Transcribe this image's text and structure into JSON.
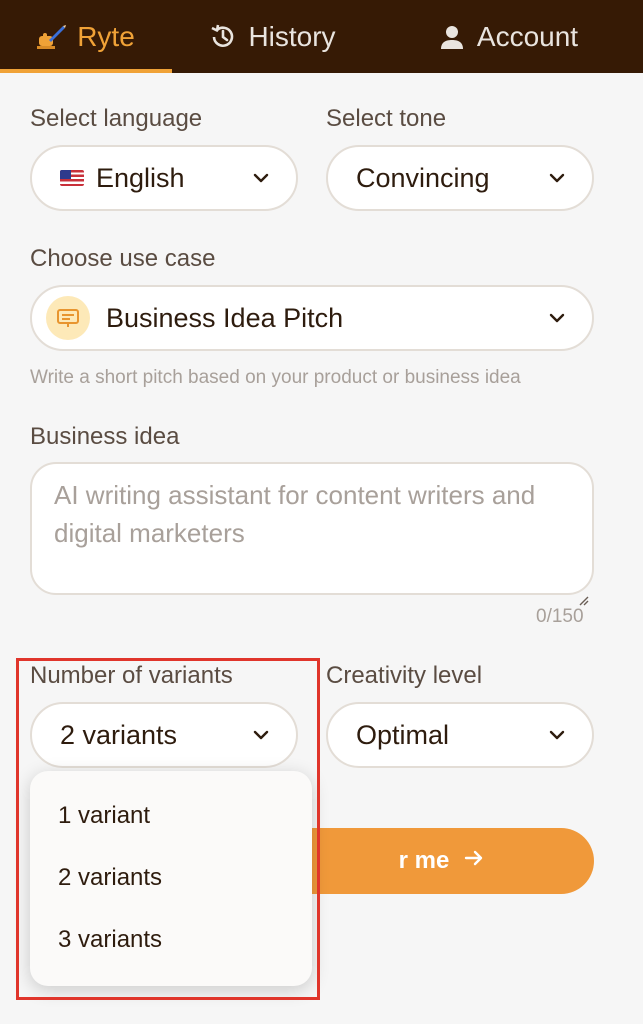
{
  "nav": {
    "tabs": [
      {
        "label": "Ryte",
        "icon": "writing-hand-icon",
        "active": true
      },
      {
        "label": "History",
        "icon": "history-icon"
      },
      {
        "label": "Account",
        "icon": "user-icon"
      }
    ]
  },
  "form": {
    "language": {
      "label": "Select language",
      "value": "English",
      "icon": "us-flag-icon"
    },
    "tone": {
      "label": "Select tone",
      "value": "Convincing"
    },
    "use_case": {
      "label": "Choose use case",
      "value": "Business Idea Pitch",
      "icon": "presentation-icon",
      "hint": "Write a short pitch based on your product or business idea"
    },
    "business_idea": {
      "label": "Business idea",
      "placeholder": "AI writing assistant for content writers and digital marketers",
      "value": "",
      "counter": "0/150"
    },
    "variants": {
      "label": "Number of variants",
      "value": "2 variants",
      "options": [
        "1 variant",
        "2 variants",
        "3 variants"
      ]
    },
    "creativity": {
      "label": "Creativity level",
      "value": "Optimal"
    },
    "submit_visible": "r me"
  },
  "colors": {
    "nav_bg": "#361a05",
    "accent": "#f0a237",
    "button": "#f0993a",
    "highlight_border": "#e0352b"
  }
}
